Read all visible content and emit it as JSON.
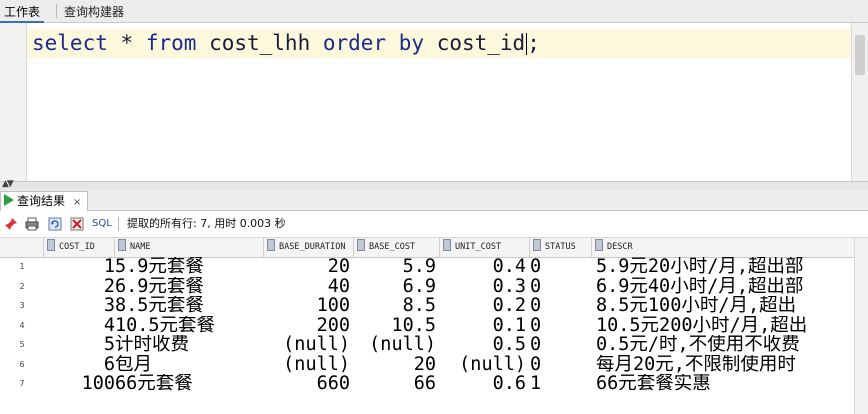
{
  "tabs": {
    "worksheet": "工作表",
    "query_builder": "查询构建器"
  },
  "editor": {
    "keyword_select": "select",
    "star": "*",
    "keyword_from": "from",
    "table": "cost_lhh",
    "keyword_order": "order",
    "keyword_by": "by",
    "column": "cost_id",
    "terminator": ";"
  },
  "results": {
    "tab_label": "查询结果",
    "close_label": "×",
    "sql_label": "SQL",
    "fetch_status": "提取的所有行: 7, 用时 0.003 秒"
  },
  "grid": {
    "columns": [
      "COST_ID",
      "NAME",
      "BASE_DURATION",
      "BASE_COST",
      "UNIT_COST",
      "STATUS",
      "DESCR"
    ],
    "rows": [
      {
        "n": "1",
        "cost_id": "1",
        "name": "5.9元套餐",
        "base_duration": "20",
        "base_cost": "5.9",
        "unit_cost": "0.4",
        "status": "0",
        "descr": "5.9元20小时/月,超出部"
      },
      {
        "n": "2",
        "cost_id": "2",
        "name": "6.9元套餐",
        "base_duration": "40",
        "base_cost": "6.9",
        "unit_cost": "0.3",
        "status": "0",
        "descr": "6.9元40小时/月,超出部"
      },
      {
        "n": "3",
        "cost_id": "3",
        "name": "8.5元套餐",
        "base_duration": "100",
        "base_cost": "8.5",
        "unit_cost": "0.2",
        "status": "0",
        "descr": "8.5元100小时/月,超出"
      },
      {
        "n": "4",
        "cost_id": "4",
        "name": "10.5元套餐",
        "base_duration": "200",
        "base_cost": "10.5",
        "unit_cost": "0.1",
        "status": "0",
        "descr": "10.5元200小时/月,超出"
      },
      {
        "n": "5",
        "cost_id": "5",
        "name": "计时收费",
        "base_duration": "(null)",
        "base_cost": "(null)",
        "unit_cost": "0.5",
        "status": "0",
        "descr": "0.5元/时,不使用不收费"
      },
      {
        "n": "6",
        "cost_id": "6",
        "name": "包月",
        "base_duration": "(null)",
        "base_cost": "20",
        "unit_cost": "(null)",
        "status": "0",
        "descr": "每月20元,不限制使用时"
      },
      {
        "n": "7",
        "cost_id": "100",
        "name": "66元套餐",
        "base_duration": "660",
        "base_cost": "66",
        "unit_cost": "0.6",
        "status": "1",
        "descr": "66元套餐实惠"
      }
    ]
  },
  "icons": [
    "pin-icon",
    "print-icon",
    "refresh-icon",
    "export-icon",
    "run-icon",
    "column-sort-icon"
  ],
  "colors": {
    "editor_line_highlight": "#fbf8dc",
    "keyword": "#1a2a8c",
    "run_green": "#2ea043"
  }
}
